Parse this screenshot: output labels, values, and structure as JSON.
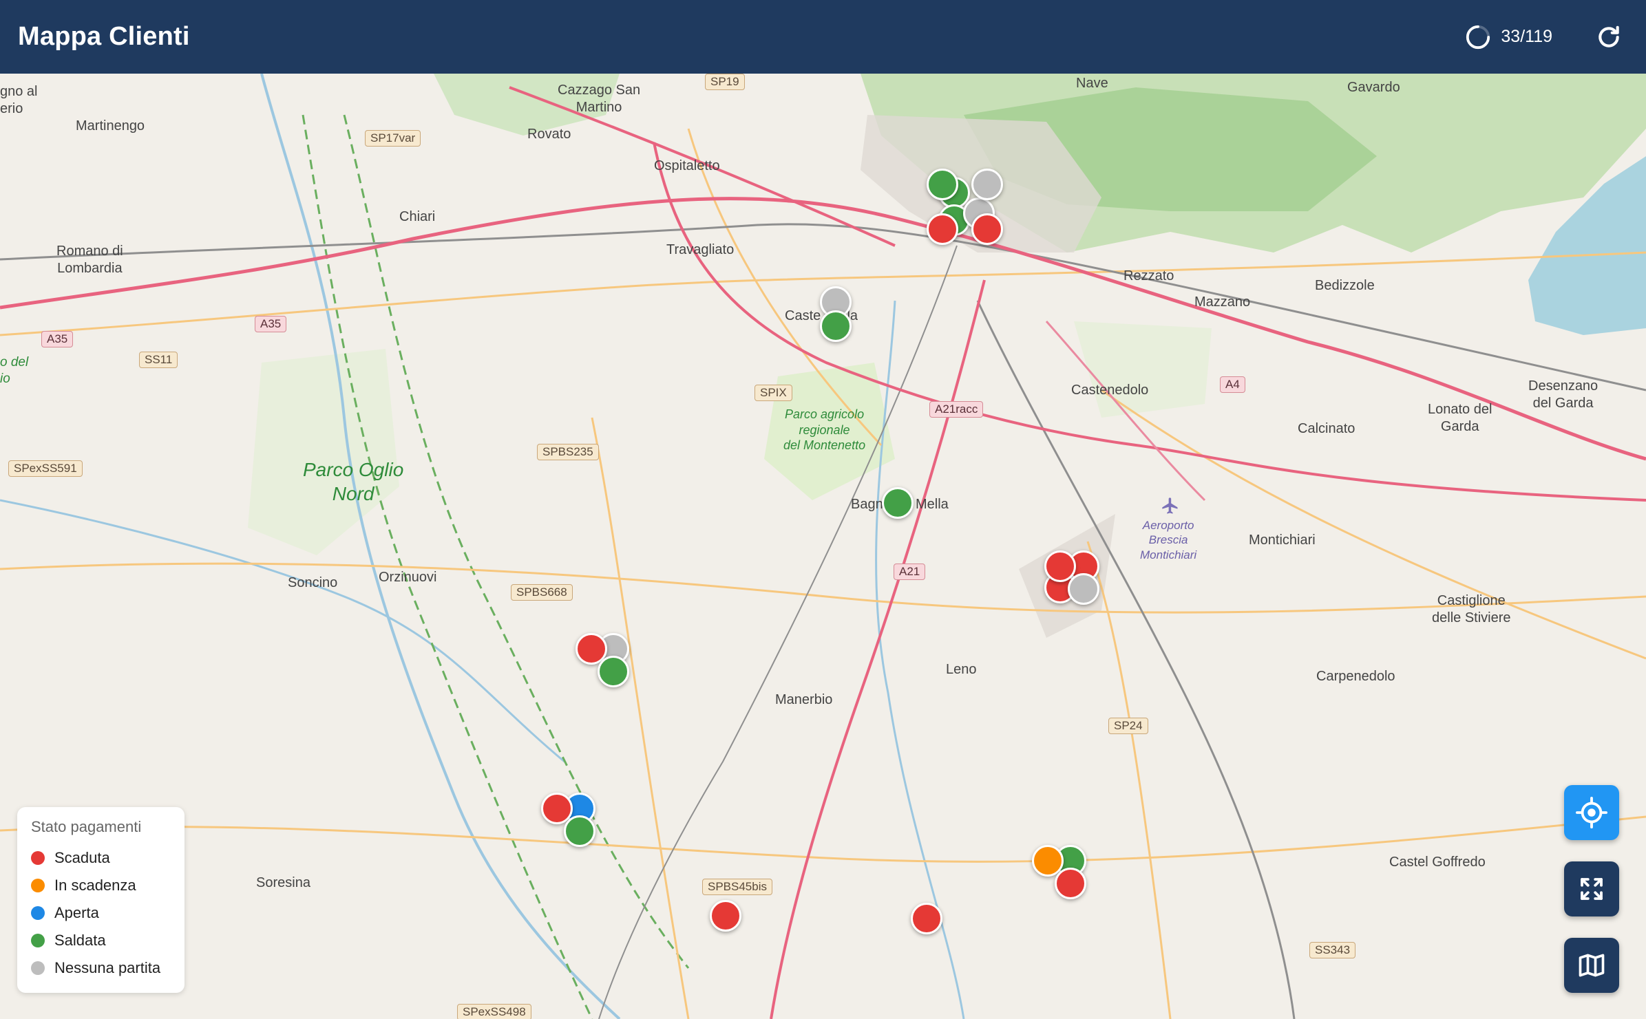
{
  "header": {
    "title": "Mappa Clienti",
    "progress_text": "33/119",
    "progress_value": 0.277
  },
  "colors": {
    "header_bg": "#1f3a5f",
    "scaduta": "#e53935",
    "in_scadenza": "#fb8c00",
    "aperta": "#1e88e5",
    "saldata": "#43a047",
    "nessuna": "#bdbdbd",
    "locate_button": "#2196f3",
    "dark_button": "#1f3a5f"
  },
  "legend": {
    "title": "Stato pagamenti",
    "items": [
      {
        "label": "Scaduta",
        "color": "#e53935"
      },
      {
        "label": "In scadenza",
        "color": "#fb8c00"
      },
      {
        "label": "Aperta",
        "color": "#1e88e5"
      },
      {
        "label": "Saldata",
        "color": "#43a047"
      },
      {
        "label": "Nessuna partita",
        "color": "#bdbdbd"
      }
    ]
  },
  "controls": {
    "locate_icon": "crosshair-icon",
    "fullscreen_icon": "expand-icon",
    "layers_icon": "map-icon"
  },
  "map": {
    "places": {
      "p1": "gno al\nerio",
      "p2": "Cazzago San\nMartino",
      "p3": "Nave",
      "p4": "Gavardo",
      "p5": "Martinengo",
      "p6": "Rovato",
      "p7": "Ospitaletto",
      "p8": "Chiari",
      "p9": "Romano di\nLombardia",
      "p10": "Travagliato",
      "p11": "Caste",
      "p12": "lla",
      "p13": "Rezzato",
      "p14": "Bedizzole",
      "p15": "Mazzano",
      "p16": "Castenedolo",
      "p17": "Calcinato",
      "p18": "Lonato del\nGarda",
      "p19": "Desenzano\ndel Garda",
      "p20": "Bagn",
      "p21": "Mella",
      "p22": "Montichiari",
      "p23": "Soncino",
      "p24": "Orzinuovi",
      "p25": "Manerbio",
      "p26": "Leno",
      "p27": "Castiglione\ndelle Stiviere",
      "p28": "Carpenedolo",
      "p29": "Soresina",
      "p30": "Castel Goffredo",
      "p31": "o del\nio"
    },
    "parks": {
      "oglio": "Parco Oglio\nNord",
      "montenetto": "Parco agricolo\nregionale\ndel Montenetto"
    },
    "airport": "Aeroporto\nBrescia\nMontichiari",
    "roads": {
      "r1": "SP19",
      "r2": "SP17var",
      "r3": "A35",
      "r4": "A35",
      "r5": "SS11",
      "r6": "SPexSS591",
      "r7": "SPBS235",
      "r8": "SPIX",
      "r9": "A21racc",
      "r10": "A4",
      "r11": "A21",
      "r12": "SPBS668",
      "r13": "SP24",
      "r14": "SPBS45bis",
      "r15": "SS343",
      "r16": "SPexSS498"
    }
  },
  "markers": [
    {
      "status": "saldata"
    },
    {
      "status": "saldata"
    },
    {
      "status": "saldata"
    },
    {
      "status": "nessuna"
    },
    {
      "status": "nessuna"
    },
    {
      "status": "scaduta"
    },
    {
      "status": "scaduta"
    },
    {
      "status": "nessuna"
    },
    {
      "status": "saldata"
    },
    {
      "status": "saldata"
    },
    {
      "status": "scaduta"
    },
    {
      "status": "scaduta"
    },
    {
      "status": "scaduta"
    },
    {
      "status": "nessuna"
    },
    {
      "status": "nessuna"
    },
    {
      "status": "scaduta"
    },
    {
      "status": "saldata"
    },
    {
      "status": "aperta"
    },
    {
      "status": "scaduta"
    },
    {
      "status": "saldata"
    },
    {
      "status": "saldata"
    },
    {
      "status": "in_scadenza"
    },
    {
      "status": "scaduta"
    },
    {
      "status": "scaduta"
    },
    {
      "status": "scaduta"
    }
  ]
}
